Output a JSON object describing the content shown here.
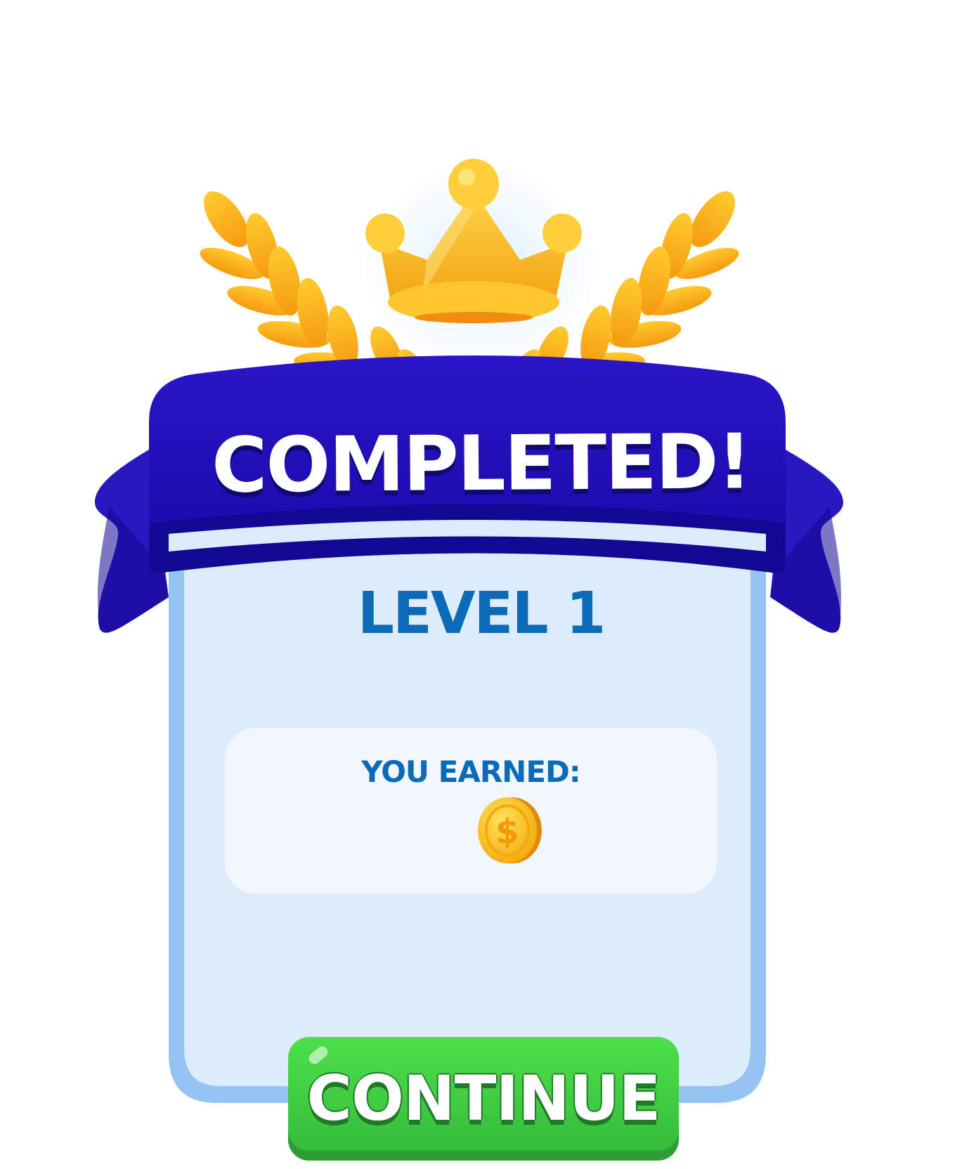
{
  "banner": {
    "title": "COMPLETED!"
  },
  "level": {
    "label": "LEVEL 1"
  },
  "reward": {
    "heading": "YOU EARNED:",
    "icon": "coin-icon"
  },
  "continue_button": {
    "label": "CONTINUE"
  },
  "colors": {
    "ribbon": "#1f0bb5",
    "panel_border": "#95c4f3",
    "panel_fill": "#dcecfa",
    "reward_box": "#f2f7fe",
    "level_text": "#0b6bb8",
    "button": "#3fc943",
    "gold": "#ffb400"
  }
}
